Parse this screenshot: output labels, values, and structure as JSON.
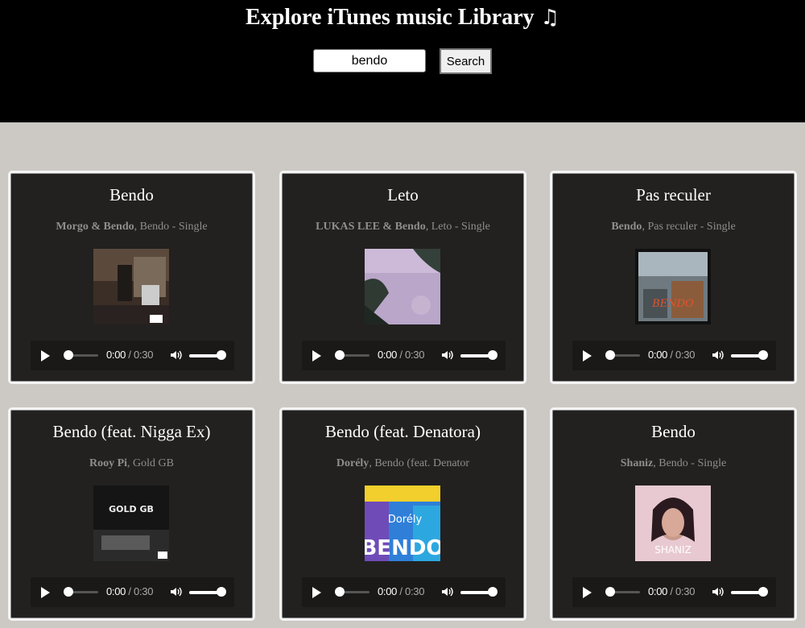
{
  "header": {
    "title": "Explore iTunes music Library",
    "note_icon": "♫",
    "search": {
      "value": "bendo",
      "button_label": "Search"
    }
  },
  "results": [
    {
      "title": "Bendo",
      "artist": "Morgo & Bendo",
      "album": ", Bendo - Single",
      "time": "0:00",
      "duration": "/ 0:30"
    },
    {
      "title": "Leto",
      "artist": "LUKAS LEE & Bendo",
      "album": ", Leto - Single",
      "time": "0:00",
      "duration": "/ 0:30"
    },
    {
      "title": "Pas reculer",
      "artist": "Bendo",
      "album": ", Pas reculer - Single",
      "time": "0:00",
      "duration": "/ 0:30"
    },
    {
      "title": "Bendo (feat. Nigga Ex)",
      "artist": "Rooy Pi",
      "album": ", Gold GB",
      "time": "0:00",
      "duration": "/ 0:30",
      "art_text": "GOLD GB"
    },
    {
      "title": "Bendo (feat. Denatora)",
      "artist": "Dorély",
      "album": ", Bendo (feat. Denator",
      "time": "0:00",
      "duration": "/ 0:30",
      "art_text": "BENDO",
      "art_text2": "Dorély"
    },
    {
      "title": "Bendo",
      "artist": "Shaniz",
      "album": ", Bendo - Single",
      "time": "0:00",
      "duration": "/ 0:30",
      "art_text": "SHANIZ"
    }
  ]
}
